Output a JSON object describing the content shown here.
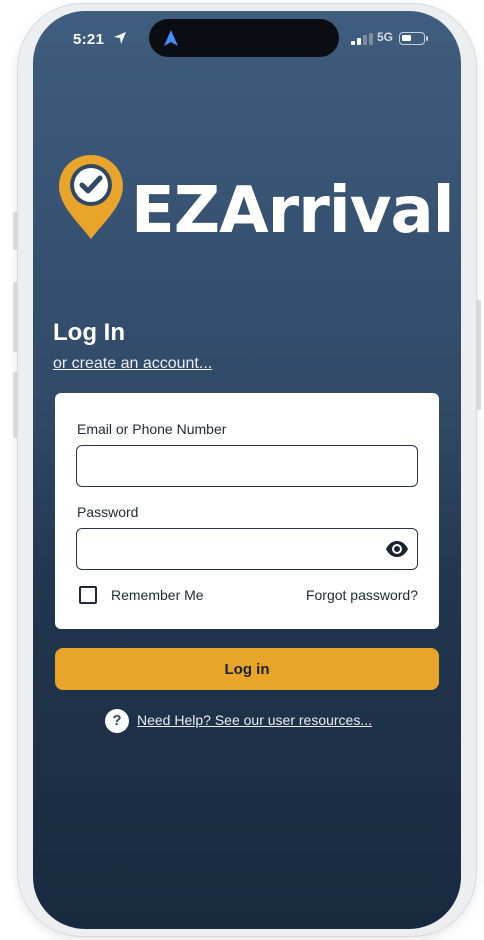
{
  "status_bar": {
    "time": "5:21",
    "network": "5G"
  },
  "brand": {
    "name": "EZArrival",
    "accent_color": "#e9a42a",
    "background_color": "#2f4866"
  },
  "login": {
    "heading": "Log In",
    "create_account_link": "or create an account...",
    "email_label": "Email or Phone Number",
    "email_value": "",
    "password_label": "Password",
    "password_value": "",
    "remember_label": "Remember Me",
    "remember_checked": false,
    "forgot_link": "Forgot password?",
    "submit_label": "Log in"
  },
  "help": {
    "icon_glyph": "?",
    "link": "Need Help? See our user resources..."
  },
  "icons": [
    "location-arrow-icon",
    "navigation-arrow-icon",
    "signal-icon",
    "battery-icon",
    "location-pin-check-icon",
    "eye-icon",
    "help-icon"
  ]
}
